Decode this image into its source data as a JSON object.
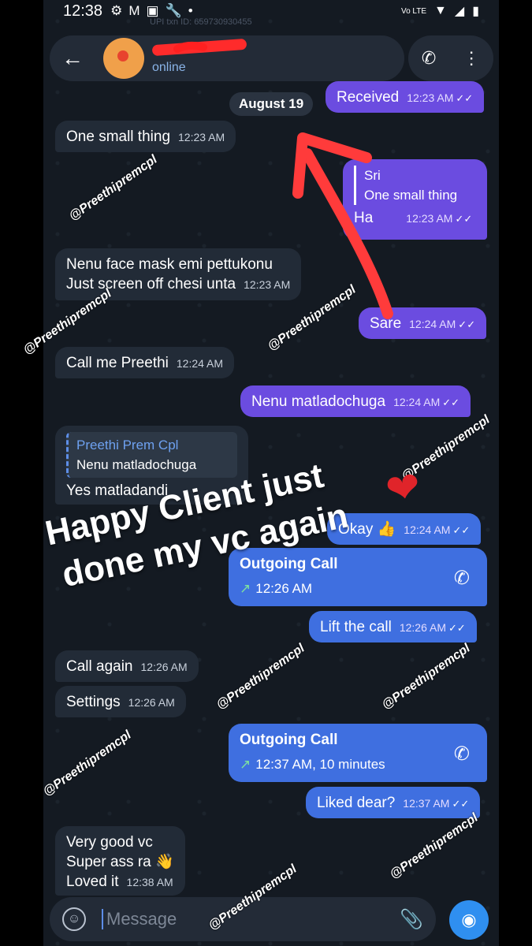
{
  "status": {
    "time": "12:38",
    "network": "Vo LTE"
  },
  "header": {
    "status": "online",
    "txn_text": "UPI txn ID: 659730930455"
  },
  "date_chip": "August 19",
  "messages": [
    {
      "text": "Received",
      "time": "12:23 AM"
    },
    {
      "text": "One small thing",
      "time": "12:23 AM"
    },
    {
      "reply_name": "Sri",
      "reply_text": "One small thing",
      "text": "Ha",
      "time": "12:23 AM"
    },
    {
      "line1": "Nenu face mask emi pettukonu",
      "line2": "Just screen off chesi unta",
      "time": "12:23 AM"
    },
    {
      "text": "Sare",
      "time": "12:24 AM"
    },
    {
      "text": "Call me Preethi",
      "time": "12:24 AM"
    },
    {
      "text": "Nenu matladochuga",
      "time": "12:24 AM"
    },
    {
      "reply_name": "Preethi Prem Cpl",
      "reply_text": "Nenu matladochuga",
      "text": "Yes matladandi"
    },
    {
      "text": "Okay 👍",
      "time": "12:24 AM"
    },
    {
      "call_title": "Outgoing Call",
      "call_sub": "12:26 AM"
    },
    {
      "text": "Lift the call",
      "time": "12:26 AM"
    },
    {
      "text": "Call again",
      "time": "12:26 AM"
    },
    {
      "text": "Settings",
      "time": "12:26 AM"
    },
    {
      "call_title": "Outgoing Call",
      "call_sub": "12:37 AM, 10 minutes"
    },
    {
      "text": "Liked dear?",
      "time": "12:37 AM"
    },
    {
      "line1": "Very good vc",
      "line2": "Super ass ra 👋",
      "line3": "Loved it",
      "time": "12:38 AM"
    }
  ],
  "overlay": {
    "line1": "Happy Client just",
    "line2": "done my vc again"
  },
  "watermark": "@Preethipremcpl",
  "composer": {
    "placeholder": "Message"
  },
  "colors": {
    "outgoing": "#6b4ce0",
    "call": "#3f6fe0",
    "incoming": "#222b37",
    "arrow": "#ff3b3b"
  },
  "icons": [
    "back-arrow-icon",
    "phone-icon",
    "more-vert-icon",
    "emoji-icon",
    "attach-icon",
    "camera-icon",
    "double-check-icon"
  ]
}
